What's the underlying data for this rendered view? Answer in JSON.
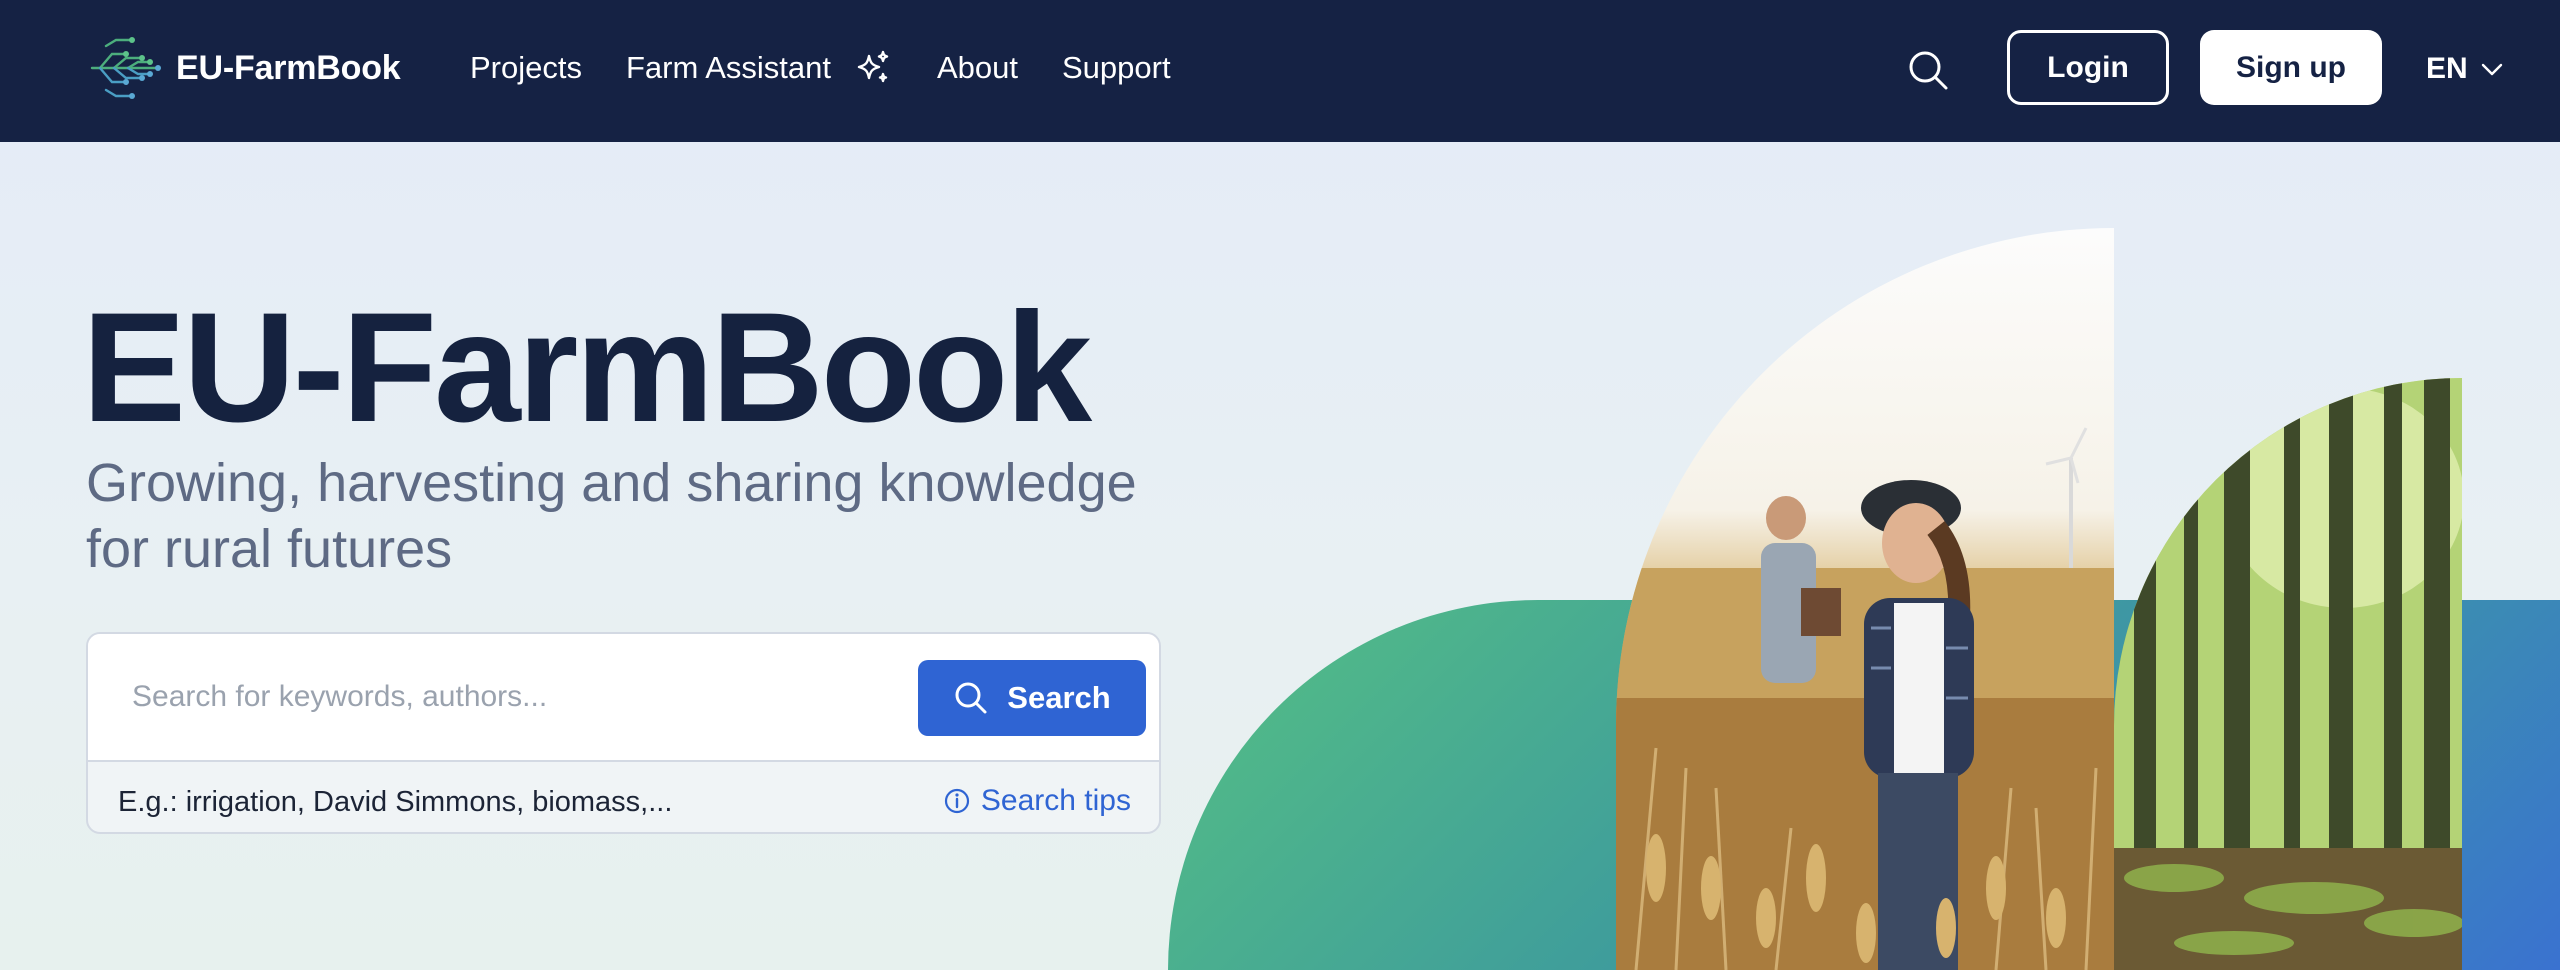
{
  "header": {
    "brand": "EU-FarmBook",
    "nav": [
      {
        "label": "Projects"
      },
      {
        "label": "Farm Assistant"
      },
      {
        "label": "About"
      },
      {
        "label": "Support"
      }
    ],
    "login_label": "Login",
    "signup_label": "Sign up",
    "language": "EN",
    "icons": {
      "logo": "tree-circuit-logo",
      "assistant": "sparkle-icon",
      "search": "search-icon",
      "language_dropdown": "chevron-down-icon"
    }
  },
  "hero": {
    "title": "EU-FarmBook",
    "subtitle": "Growing, harvesting and sharing knowledge for rural futures"
  },
  "search": {
    "placeholder": "Search for keywords, authors...",
    "value": "",
    "button_label": "Search",
    "examples": "E.g.: irrigation, David Simmons, biomass,...",
    "tips_label": "Search tips"
  },
  "colors": {
    "nav_bg": "#152244",
    "accent": "#2f64d3",
    "title": "#15223f",
    "subtitle": "#5e6a84",
    "art_green": "#55c084",
    "art_blue": "#3a72d0"
  }
}
